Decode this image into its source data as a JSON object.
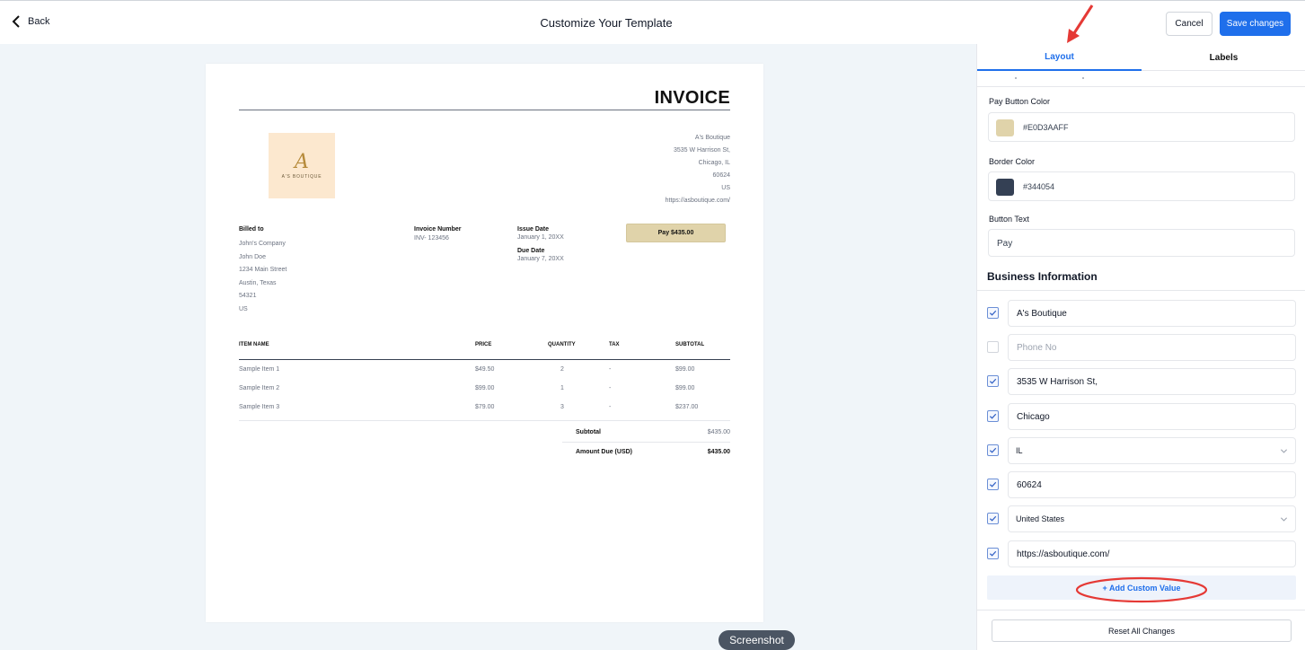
{
  "header": {
    "back_label": "Back",
    "title": "Customize Your Template",
    "cancel_label": "Cancel",
    "save_label": "Save changes"
  },
  "invoice": {
    "title": "INVOICE",
    "logo": {
      "monogram": "A",
      "brand": "A'S BOUTIQUE"
    },
    "business_address": [
      "A's Boutique",
      "3535 W Harrison St,",
      "Chicago, IL",
      "60624",
      "US",
      "https://asboutique.com/"
    ],
    "billed_to_label": "Billed to",
    "billed_to": [
      "John's Company",
      "John Doe",
      "1234 Main Street",
      "Austin, Texas",
      "54321",
      "US"
    ],
    "invoice_number_label": "Invoice Number",
    "invoice_number": "INV- 123456",
    "issue_date_label": "Issue Date",
    "issue_date": "January 1, 20XX",
    "due_date_label": "Due Date",
    "due_date": "January 7, 20XX",
    "pay_button": "Pay $435.00",
    "columns": {
      "name": "ITEM NAME",
      "price": "PRICE",
      "quantity": "QUANTITY",
      "tax": "TAX",
      "subtotal": "SUBTOTAL"
    },
    "items": [
      {
        "name": "Sample Item 1",
        "price": "$49.50",
        "quantity": "2",
        "tax": "-",
        "subtotal": "$99.00"
      },
      {
        "name": "Sample Item 2",
        "price": "$99.00",
        "quantity": "1",
        "tax": "-",
        "subtotal": "$99.00"
      },
      {
        "name": "Sample Item 3",
        "price": "$79.00",
        "quantity": "3",
        "tax": "-",
        "subtotal": "$237.00"
      }
    ],
    "subtotal_label": "Subtotal",
    "subtotal_value": "$435.00",
    "amount_due_label": "Amount Due (USD)",
    "amount_due_value": "$435.00"
  },
  "overlay": {
    "screenshot_label": "Screenshot"
  },
  "panel": {
    "tabs": [
      {
        "label": "Layout",
        "active": true
      },
      {
        "label": "Labels",
        "active": false
      }
    ],
    "pay_button_color_label": "Pay Button Color",
    "pay_button_color": "#E0D3AAFF",
    "border_color_label": "Border Color",
    "border_color": "#344054",
    "button_text_label": "Button Text",
    "button_text": "Pay",
    "business_info_title": "Business Information",
    "business_fields": [
      {
        "checked": true,
        "value": "A's Boutique",
        "placeholder": "",
        "type": "input"
      },
      {
        "checked": false,
        "value": "",
        "placeholder": "Phone No",
        "type": "input"
      },
      {
        "checked": true,
        "value": "3535 W Harrison St,",
        "placeholder": "",
        "type": "input"
      },
      {
        "checked": true,
        "value": "Chicago",
        "placeholder": "",
        "type": "input"
      },
      {
        "checked": true,
        "value": "IL",
        "placeholder": "",
        "type": "select"
      },
      {
        "checked": true,
        "value": "60624",
        "placeholder": "",
        "type": "input"
      },
      {
        "checked": true,
        "value": "United States",
        "placeholder": "",
        "type": "select"
      },
      {
        "checked": true,
        "value": "https://asboutique.com/",
        "placeholder": "",
        "type": "input"
      }
    ],
    "add_custom_value_label": "+ Add Custom Value",
    "reset_label": "Reset All Changes"
  },
  "colors": {
    "accent": "#1f6feb",
    "canvas_bg": "#f0f5f9",
    "annotation_red": "#e53935",
    "pay_swatch": "#E0D3AA",
    "border_swatch": "#344054"
  },
  "icons": {
    "back": "chevron-left-icon",
    "check": "checkmark-icon",
    "select": "chevron-down-icon"
  }
}
